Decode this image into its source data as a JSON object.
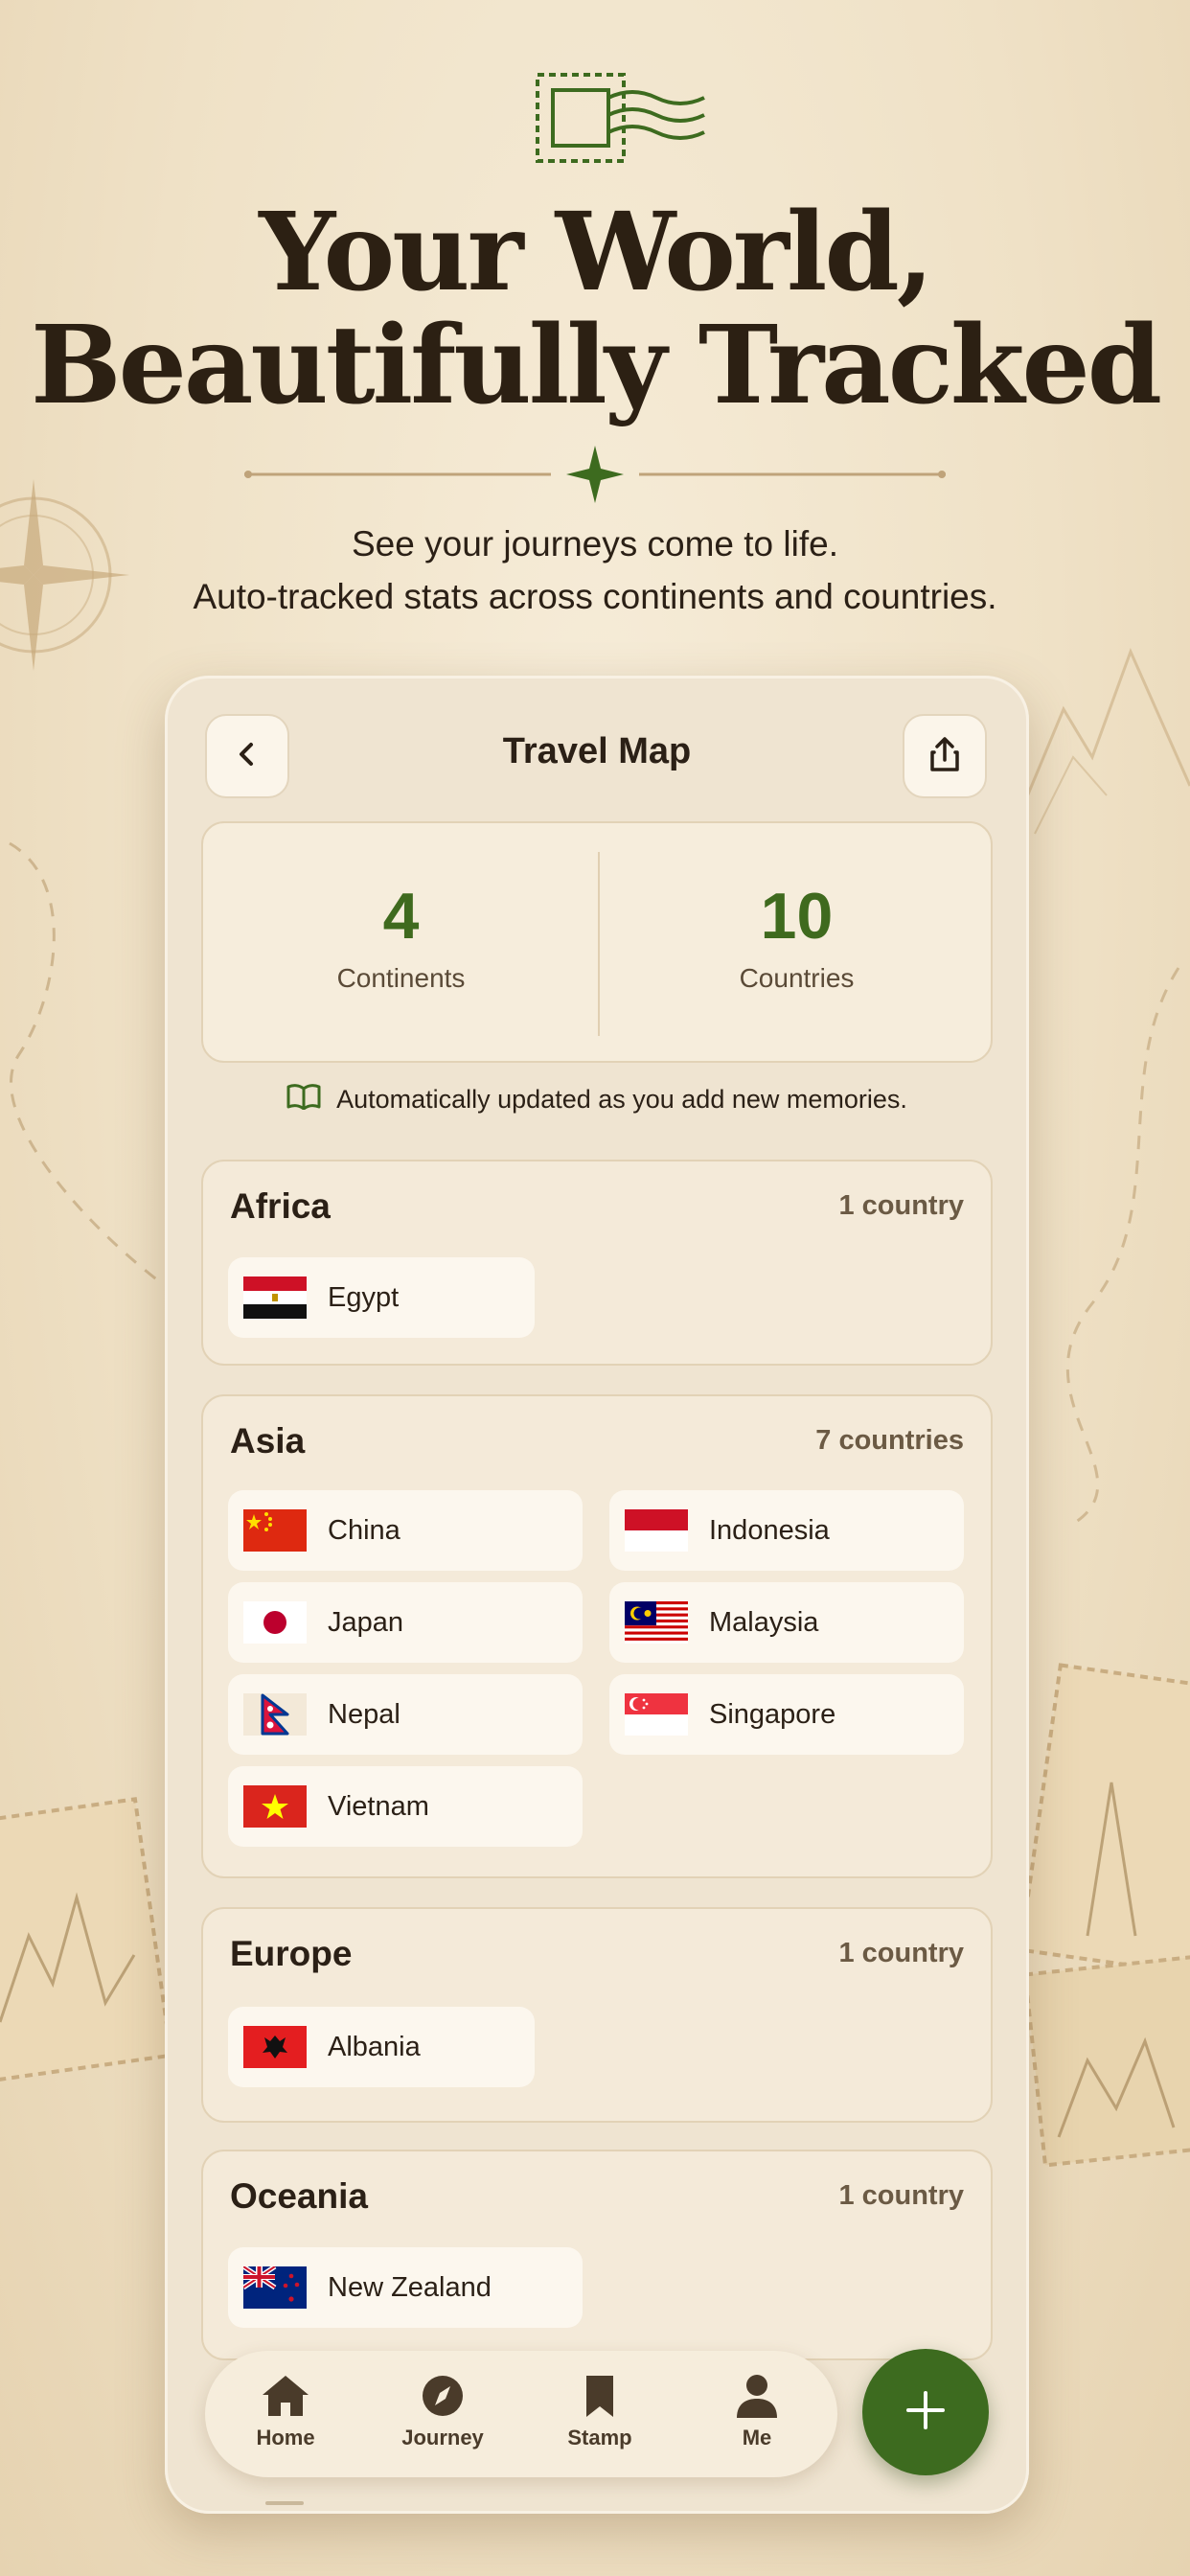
{
  "hero": {
    "headline_line1": "Your World,",
    "headline_line2": "Beautifully Tracked",
    "subtitle_line1": "See your journeys come to life.",
    "subtitle_line2": "Auto-tracked stats across continents and countries."
  },
  "screen": {
    "title": "Travel Map",
    "back_icon": "chevron-left-icon",
    "share_icon": "share-icon"
  },
  "stats": {
    "continents_value": "4",
    "continents_label": "Continents",
    "countries_value": "10",
    "countries_label": "Countries"
  },
  "note": "Automatically updated as you add new memories.",
  "sections": [
    {
      "name": "Africa",
      "count": "1 country",
      "countries": [
        "Egypt"
      ]
    },
    {
      "name": "Asia",
      "count": "7 countries",
      "countries": [
        "China",
        "Indonesia",
        "Japan",
        "Malaysia",
        "Nepal",
        "Singapore",
        "Vietnam"
      ]
    },
    {
      "name": "Europe",
      "count": "1 country",
      "countries": [
        "Albania"
      ]
    },
    {
      "name": "Oceania",
      "count": "1 country",
      "countries": [
        "New Zealand"
      ]
    }
  ],
  "nav": {
    "items": [
      {
        "label": "Home",
        "icon": "home-icon"
      },
      {
        "label": "Journey",
        "icon": "compass-icon"
      },
      {
        "label": "Stamp",
        "icon": "bookmark-icon"
      },
      {
        "label": "Me",
        "icon": "person-icon"
      }
    ],
    "fab_icon": "plus-icon"
  },
  "colors": {
    "accent_green": "#3d6b1f",
    "background": "#f3e7d0",
    "text": "#2b2016"
  }
}
